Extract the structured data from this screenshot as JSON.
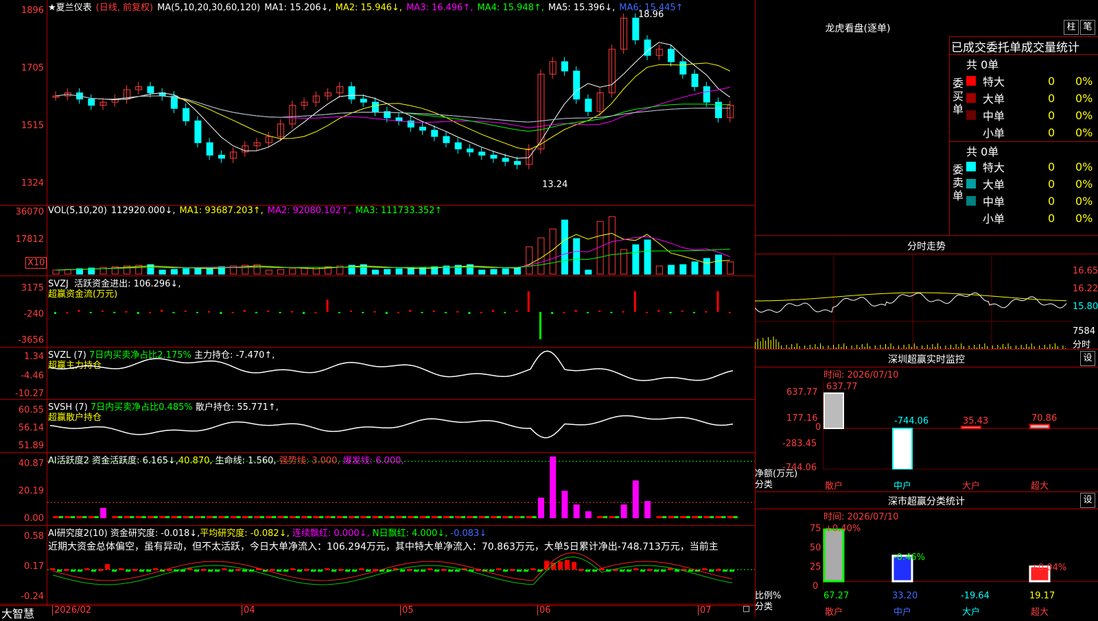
{
  "main": {
    "stock_name": "★夏兰仪表",
    "period": "(日线, 前复权)",
    "ma_label": "MA(5,10,20,30,60,120)",
    "ma1": "MA1: 15.206↓,",
    "ma2": "MA2: 15.946↓,",
    "ma3": "MA3: 16.496↑,",
    "ma4": "MA4: 15.948↑,",
    "ma5": "MA5: 15.396↓,",
    "ma6": "MA6: 15.445↑",
    "y_ticks": [
      "1896",
      "1705",
      "1515",
      "1324"
    ],
    "high_label": "18.96",
    "low_label": "13.24"
  },
  "vol": {
    "title": "VOL(5,10,20)",
    "value": "112920.000↓,",
    "ma1": "MA1: 93687.203↑,",
    "ma2": "MA2: 92080.102↑,",
    "ma3": "MA3: 111733.352↑",
    "y_ticks": [
      "36070",
      "17812"
    ],
    "unit": "X10"
  },
  "svzj": {
    "title": "SVZJ",
    "label": "活跃资金进出: 106.296↓,",
    "sub": "超赢资金流(万元)",
    "y_ticks": [
      "3175",
      "-240",
      "-3656"
    ]
  },
  "svzl": {
    "title": "SVZL (7)",
    "label": "7日内买卖净占比2.175%",
    "label2": "主力持仓: -7.470↑,",
    "sub": "超赢主力持仓",
    "y_ticks": [
      "1.34",
      "-4.46",
      "-10.27"
    ]
  },
  "svsh": {
    "title": "SVSH (7)",
    "label": "7日内买卖净占比0.485%",
    "label2": "散户持仓: 55.771↑,",
    "sub": "超赢散户持仓",
    "y_ticks": [
      "60.55",
      "56.14",
      "51.89"
    ]
  },
  "ai1": {
    "title": "AI活跃度2",
    "l1": "资金活跃度: 6.165↓,",
    "l2": "40.870,",
    "l3": "生命线: 1.560,",
    "l4": "强势线: 3.000,",
    "l5": "爆发线: 6.000,",
    "y_ticks": [
      "40.87",
      "20.19",
      "0.00"
    ]
  },
  "ai2": {
    "title": "AI研究度2(10)",
    "l1": "资金研究度: -0.018↓,",
    "l2": "平均研究度: -0.082↓,",
    "l3": "连续飘红: 0.000↓,",
    "l4": "N日飘红: 4.000↓,",
    "l5": "-0.083↓",
    "desc": "近期大资金总体偏空，虽有异动，但不太活跃，今日大单净流入：106.294万元，其中特大单净流入：70.863万元，大单5日累计净出-748.713万元，当前主",
    "y_ticks": [
      "0.58",
      "0.17",
      "-0.24"
    ]
  },
  "xaxis": {
    "brand": "大智慧",
    "labels": [
      "2026/02",
      "04",
      "05",
      "06",
      "07"
    ]
  },
  "dragon": {
    "title": "龙虎看盘(逐单)",
    "btn1": "柱",
    "btn2": "笔",
    "tabs": "已成交委托单成交量统计",
    "buy_total": "共 0单",
    "sell_total": "共 0单",
    "buy_label": "委买单",
    "sell_label": "委卖单",
    "buy_rows": [
      {
        "name": "特大",
        "v": "0",
        "p": "0%",
        "color": "#ff0000"
      },
      {
        "name": "大单",
        "v": "0",
        "p": "0%",
        "color": "#a00000"
      },
      {
        "name": "中单",
        "v": "0",
        "p": "0%",
        "color": "#6a0000"
      },
      {
        "name": "小单",
        "v": "0",
        "p": "0%",
        "color": ""
      }
    ],
    "sell_rows": [
      {
        "name": "特大",
        "v": "0",
        "p": "0%",
        "color": "#00ffff"
      },
      {
        "name": "大单",
        "v": "0",
        "p": "0%",
        "color": "#00a0a0"
      },
      {
        "name": "中单",
        "v": "0",
        "p": "0%",
        "color": "#008080"
      },
      {
        "name": "小单",
        "v": "0",
        "p": "0%",
        "color": ""
      }
    ]
  },
  "intraday": {
    "title": "分时走势",
    "y_ticks": [
      "16.65",
      "16.22",
      "15.80",
      "7584"
    ],
    "unit": "分时"
  },
  "monitor": {
    "title": "深圳超赢实时监控",
    "btn": "设",
    "time": "时间: 2026/07/10",
    "y_ticks": [
      "637.77",
      "177.16",
      "0",
      "-283.45",
      "-744.06"
    ],
    "ylabel": "净额(万元)",
    "xlabel": "分类",
    "cats": [
      "散户",
      "中户",
      "大户",
      "超大"
    ],
    "values": [
      "637.77",
      "-744.06",
      "35.43",
      "70.86"
    ]
  },
  "classify": {
    "title": "深市超赢分类统计",
    "btn": "设",
    "time": "时间: 2026/07/10",
    "y_ticks": [
      "75",
      "50",
      "25",
      "0"
    ],
    "ylabel": "比例%",
    "xlabel": "分类",
    "cats": [
      "散户",
      "中户",
      "大户",
      "超大"
    ],
    "pct": [
      "+0.40%",
      "-0.46%",
      "",
      "+0.04%"
    ],
    "values": [
      "67.27",
      "33.20",
      "-19.64",
      "19.17"
    ]
  },
  "chart_data": {
    "type": "candlestick",
    "title": "★夏兰仪表",
    "ylim": [
      13.24,
      18.96
    ],
    "x_labels": [
      "2026/02",
      "04",
      "05",
      "06",
      "07"
    ],
    "series": [
      {
        "name": "close",
        "values": [
          16.1,
          16.2,
          16.0,
          15.8,
          15.9,
          16.0,
          16.3,
          16.4,
          16.2,
          16.1,
          15.7,
          15.3,
          14.6,
          14.2,
          14.1,
          14.3,
          14.5,
          14.6,
          14.8,
          15.2,
          15.8,
          15.9,
          16.1,
          16.2,
          16.4,
          16.0,
          15.9,
          15.6,
          15.4,
          15.3,
          15.1,
          15.0,
          14.8,
          14.6,
          14.4,
          14.3,
          14.2,
          14.1,
          14.0,
          13.9,
          14.4,
          16.8,
          17.2,
          16.9,
          16.0,
          15.6,
          16.2,
          17.6,
          18.6,
          17.9,
          17.4,
          17.6,
          17.2,
          16.8,
          16.4,
          15.9,
          15.4,
          15.8
        ]
      }
    ]
  }
}
